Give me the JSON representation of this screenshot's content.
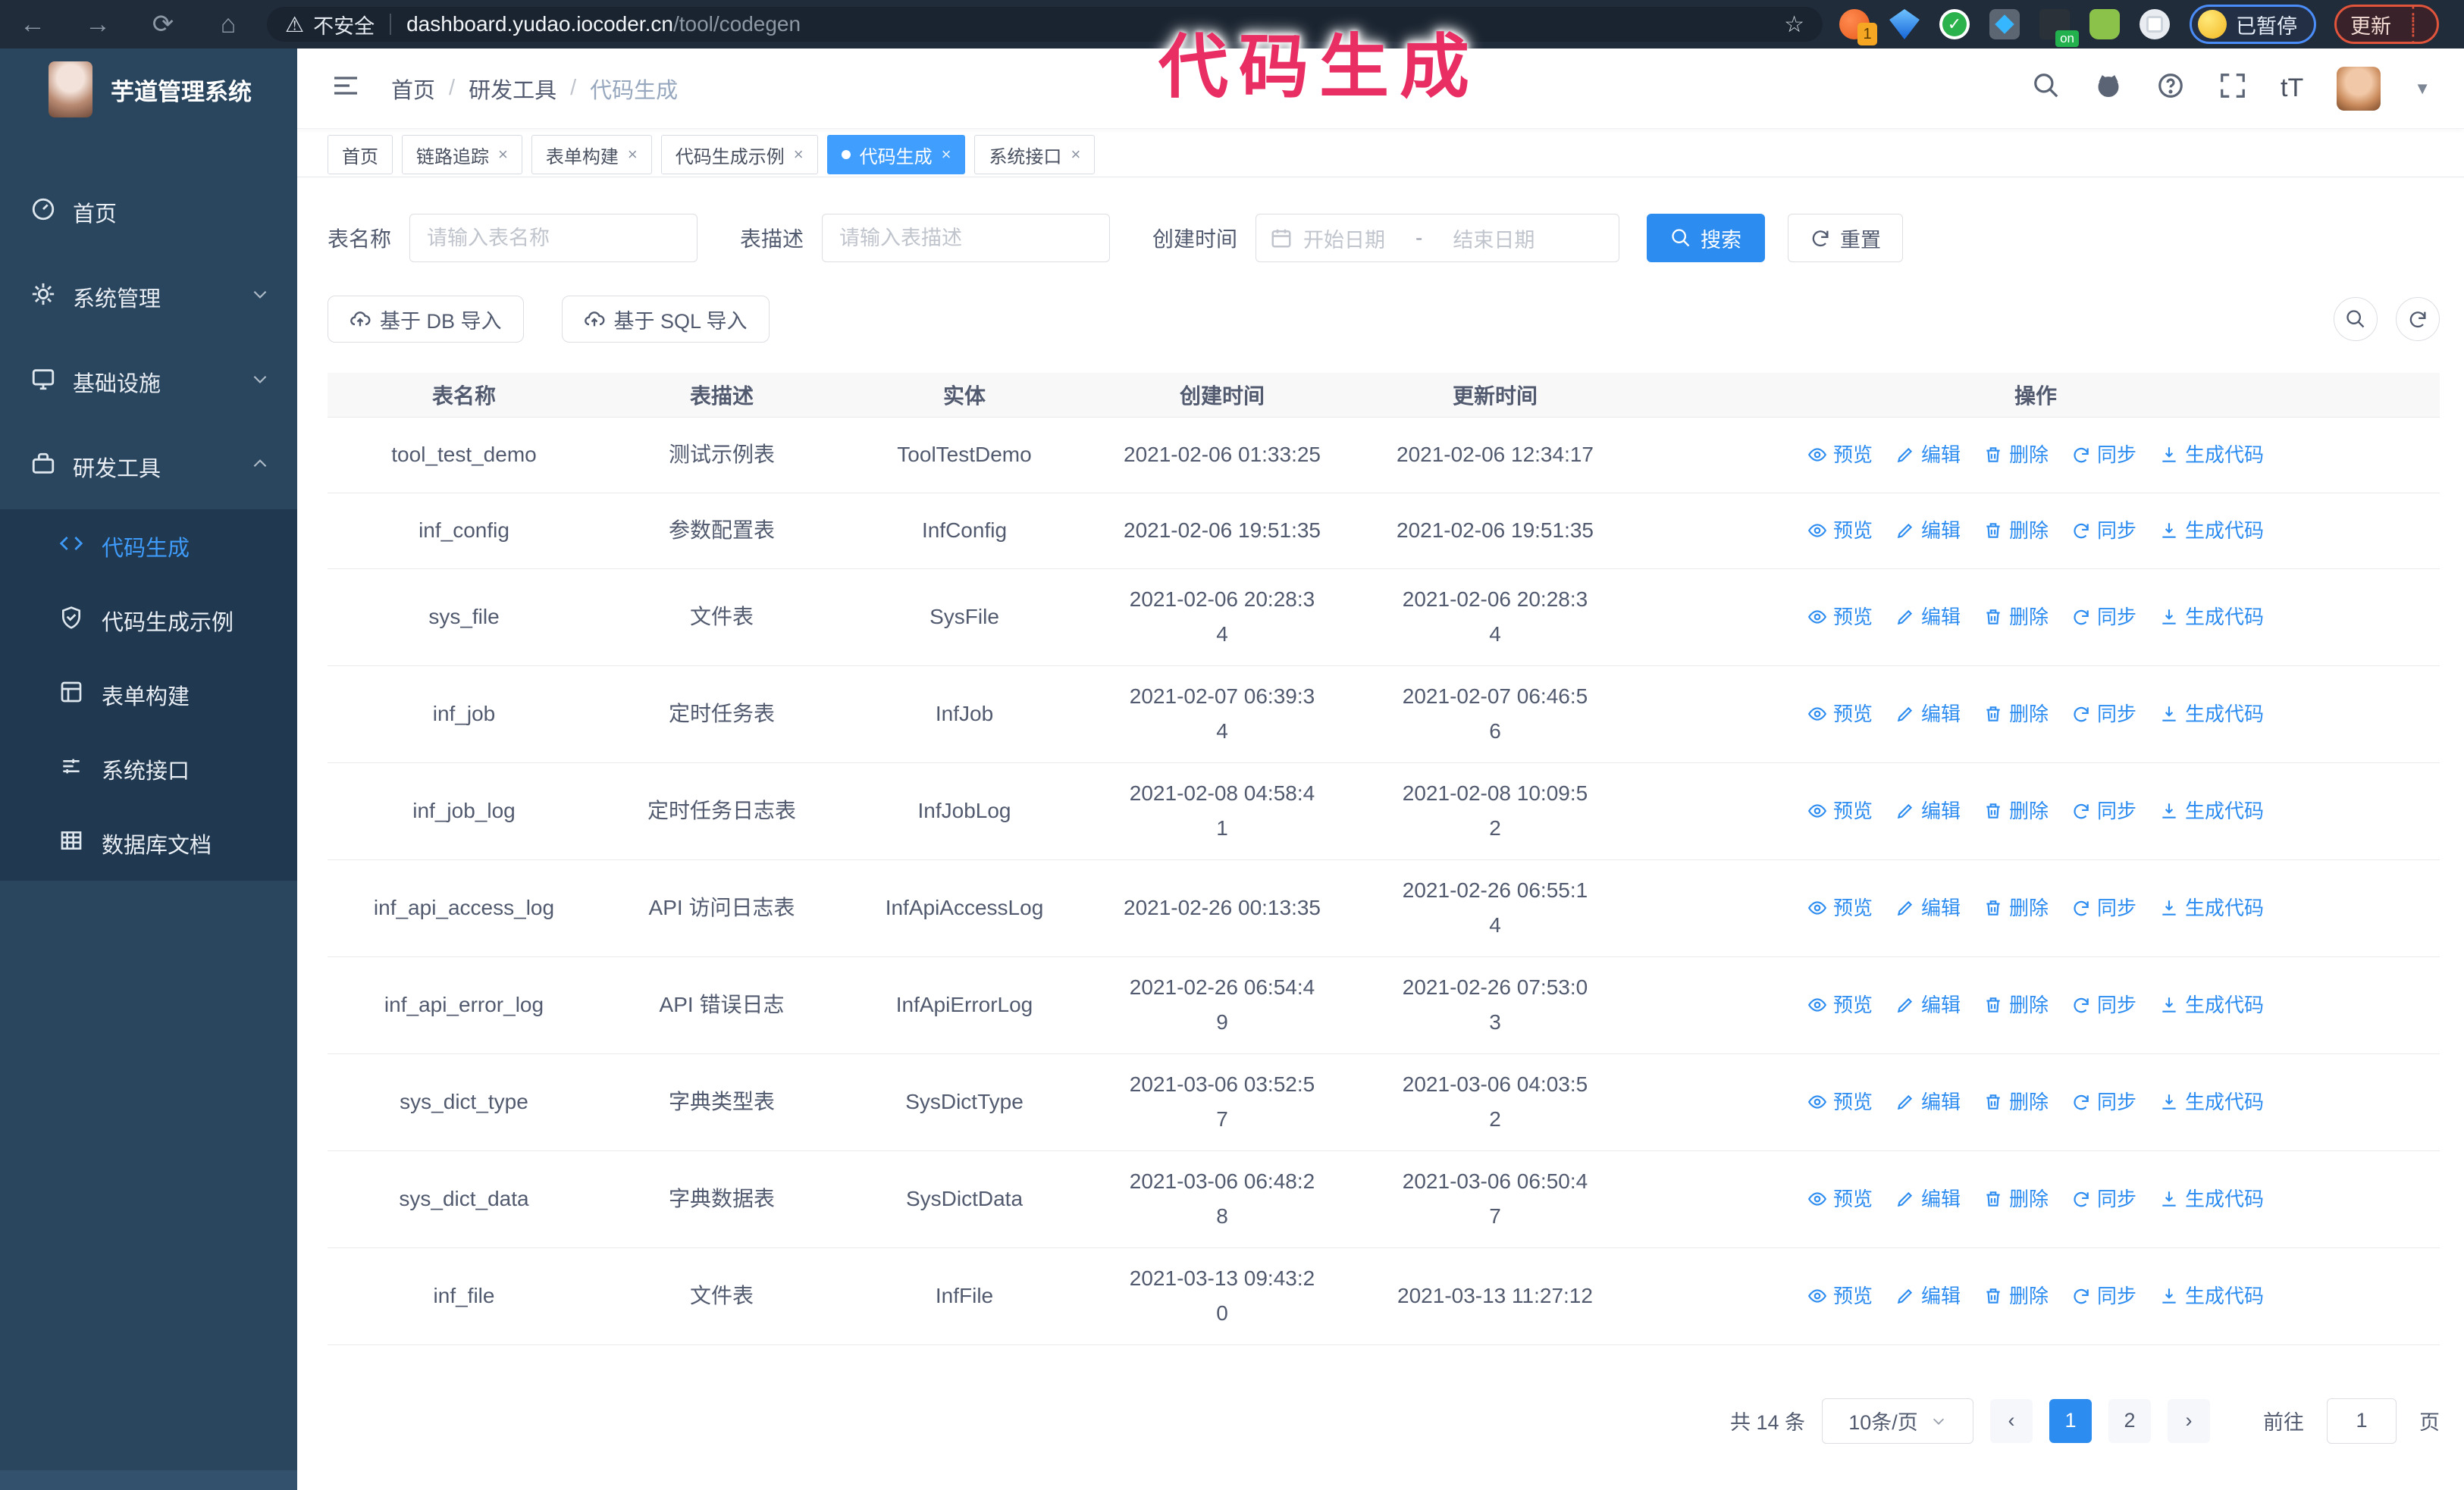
{
  "browser": {
    "security_label": "不安全",
    "url_host": "dashboard.yudao.iocoder.cn",
    "url_path": "/tool/codegen",
    "extension_badge": "1",
    "extension_on_badge": "on",
    "paused_badge": "已暂停",
    "update_button": "更新"
  },
  "annotation": {
    "text": "代码生成",
    "color": "#e92e63"
  },
  "sidebar": {
    "app_title": "芋道管理系统",
    "items": [
      {
        "label": "首页"
      },
      {
        "label": "系统管理"
      },
      {
        "label": "基础设施"
      },
      {
        "label": "研发工具"
      }
    ],
    "subitems": [
      {
        "label": "代码生成"
      },
      {
        "label": "代码生成示例"
      },
      {
        "label": "表单构建"
      },
      {
        "label": "系统接口"
      },
      {
        "label": "数据库文档"
      }
    ]
  },
  "navbar": {
    "breadcrumb": [
      "首页",
      "研发工具",
      "代码生成"
    ],
    "separator": "/"
  },
  "tabs": [
    {
      "label": "首页"
    },
    {
      "label": "链路追踪"
    },
    {
      "label": "表单构建"
    },
    {
      "label": "代码生成示例"
    },
    {
      "label": "代码生成"
    },
    {
      "label": "系统接口"
    }
  ],
  "filters": {
    "table_name_label": "表名称",
    "table_name_placeholder": "请输入表名称",
    "table_desc_label": "表描述",
    "table_desc_placeholder": "请输入表描述",
    "create_time_label": "创建时间",
    "start_placeholder": "开始日期",
    "range_separator": "-",
    "end_placeholder": "结束日期",
    "search_label": "搜索",
    "reset_label": "重置"
  },
  "toolbar": {
    "import_db_label": "基于 DB 导入",
    "import_sql_label": "基于 SQL 导入"
  },
  "table": {
    "columns": [
      "表名称",
      "表描述",
      "实体",
      "创建时间",
      "更新时间",
      "操作"
    ],
    "actions": [
      "预览",
      "编辑",
      "删除",
      "同步",
      "生成代码"
    ],
    "rows": [
      {
        "name": "tool_test_demo",
        "desc": "测试示例表",
        "entity": "ToolTestDemo",
        "created": "2021-02-06 01:33:25",
        "updated": "2021-02-06 12:34:17"
      },
      {
        "name": "inf_config",
        "desc": "参数配置表",
        "entity": "InfConfig",
        "created": "2021-02-06 19:51:35",
        "updated": "2021-02-06 19:51:35"
      },
      {
        "name": "sys_file",
        "desc": "文件表",
        "entity": "SysFile",
        "created": "2021-02-06 20:28:3\n4",
        "updated": "2021-02-06 20:28:3\n4"
      },
      {
        "name": "inf_job",
        "desc": "定时任务表",
        "entity": "InfJob",
        "created": "2021-02-07 06:39:3\n4",
        "updated": "2021-02-07 06:46:5\n6"
      },
      {
        "name": "inf_job_log",
        "desc": "定时任务日志表",
        "entity": "InfJobLog",
        "created": "2021-02-08 04:58:4\n1",
        "updated": "2021-02-08 10:09:5\n2"
      },
      {
        "name": "inf_api_access_log",
        "desc": "API 访问日志表",
        "entity": "InfApiAccessLog",
        "created": "2021-02-26 00:13:35",
        "updated": "2021-02-26 06:55:1\n4"
      },
      {
        "name": "inf_api_error_log",
        "desc": "API 错误日志",
        "entity": "InfApiErrorLog",
        "created": "2021-02-26 06:54:4\n9",
        "updated": "2021-02-26 07:53:0\n3"
      },
      {
        "name": "sys_dict_type",
        "desc": "字典类型表",
        "entity": "SysDictType",
        "created": "2021-03-06 03:52:5\n7",
        "updated": "2021-03-06 04:03:5\n2"
      },
      {
        "name": "sys_dict_data",
        "desc": "字典数据表",
        "entity": "SysDictData",
        "created": "2021-03-06 06:48:2\n8",
        "updated": "2021-03-06 06:50:4\n7"
      },
      {
        "name": "inf_file",
        "desc": "文件表",
        "entity": "InfFile",
        "created": "2021-03-13 09:43:2\n0",
        "updated": "2021-03-13 11:27:12"
      }
    ]
  },
  "pagination": {
    "total": "共 14 条",
    "page_size": "10条/页",
    "pages": [
      "1",
      "2"
    ],
    "goto_label": "前往",
    "goto_value": "1",
    "page_suffix": "页"
  }
}
